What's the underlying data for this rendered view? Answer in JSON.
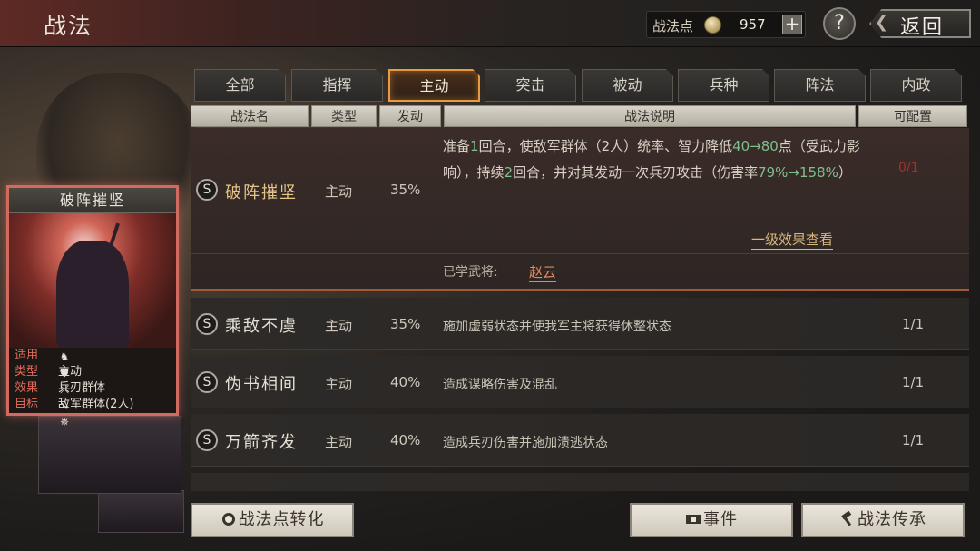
{
  "header": {
    "title": "战法",
    "points_label": "战法点",
    "points_value": "957",
    "plus_label": "+",
    "help_label": "?",
    "back_label": "返回"
  },
  "tabs": [
    {
      "label": "全部"
    },
    {
      "label": "指挥"
    },
    {
      "label": "主动",
      "active": true
    },
    {
      "label": "突击"
    },
    {
      "label": "被动"
    },
    {
      "label": "兵种"
    },
    {
      "label": "阵法"
    },
    {
      "label": "内政"
    }
  ],
  "columns": {
    "name": "战法名",
    "type": "类型",
    "rate": "发动",
    "desc": "战法说明",
    "config": "可配置"
  },
  "expanded_skill": {
    "grade": "S",
    "name": "破阵摧坚",
    "type": "主动",
    "rate": "35%",
    "desc_parts": {
      "p1": "准备",
      "n1": "1",
      "p2": "回合，使敌军群体（2人）统率、智力降低",
      "n2": "40→80",
      "p3": "点（受武力影响），持续",
      "n3": "2",
      "p4": "回合，并对其发动一次兵刃攻击（伤害率",
      "n4": "79%→158%",
      "p5": "）"
    },
    "config": "0/1",
    "effect_link": "一级效果查看",
    "learned_label": "已学武将:",
    "learned_general": "赵云"
  },
  "skills": [
    {
      "grade": "S",
      "name": "乘敌不虞",
      "type": "主动",
      "rate": "35%",
      "desc": "施加虚弱状态并使我军主将获得休整状态",
      "config": "1/1"
    },
    {
      "grade": "S",
      "name": "伪书相间",
      "type": "主动",
      "rate": "40%",
      "desc": "造成谋略伤害及混乱",
      "config": "1/1"
    },
    {
      "grade": "S",
      "name": "万箭齐发",
      "type": "主动",
      "rate": "40%",
      "desc": "造成兵刃伤害并施加溃逃状态",
      "config": "1/1"
    }
  ],
  "card": {
    "title": "破阵摧坚",
    "rows": [
      {
        "key": "适用",
        "val": ""
      },
      {
        "key": "类型",
        "val": "主动"
      },
      {
        "key": "效果",
        "val": "兵刃群体"
      },
      {
        "key": "目标",
        "val": "敌军群体(2人)"
      }
    ],
    "unit_icons": [
      "cavalry-icon",
      "shield-icon",
      "bow-icon",
      "spear-icon",
      "wheel-icon"
    ]
  },
  "buttons": {
    "convert": "战法点转化",
    "events": "事件",
    "inherit": "战法传承"
  },
  "colors": {
    "accent_orange": "#e79a3f",
    "highlight_green": "#7fbf8e",
    "config_red": "#a3302a",
    "card_border": "#d16a5f"
  }
}
